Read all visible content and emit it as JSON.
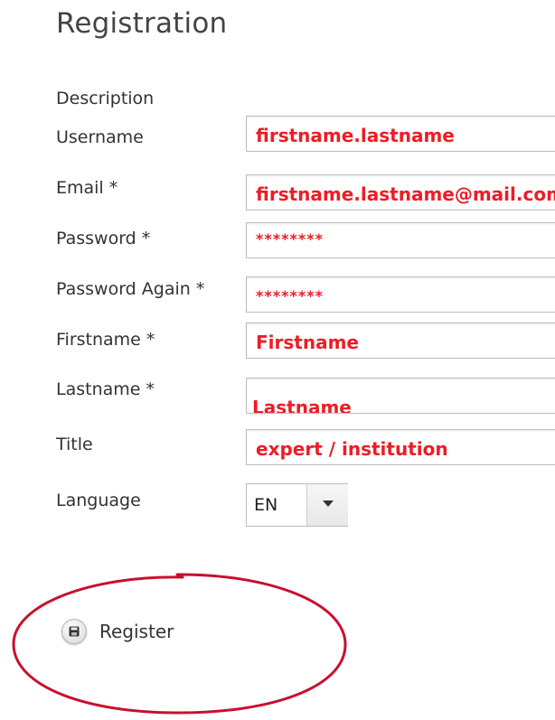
{
  "page": {
    "title": "Registration",
    "description_label": "Description"
  },
  "form": {
    "fields": [
      {
        "label": "Username",
        "value": "firstname.lastname"
      },
      {
        "label": "Email *",
        "value": "firstname.lastname@mail.com"
      },
      {
        "label": "Password *",
        "value": "********"
      },
      {
        "label": "Password Again *",
        "value": "********"
      },
      {
        "label": "Firstname *",
        "value": "Firstname"
      },
      {
        "label": "Lastname *",
        "value": "Lastname"
      },
      {
        "label": "Title",
        "value": "expert / institution"
      }
    ],
    "language": {
      "label": "Language",
      "selected": "EN"
    }
  },
  "actions": {
    "register_label": "Register",
    "register_icon": "save-icon"
  },
  "colors": {
    "field_text": "#ee1c25",
    "annotation_ellipse": "#c8102e"
  }
}
